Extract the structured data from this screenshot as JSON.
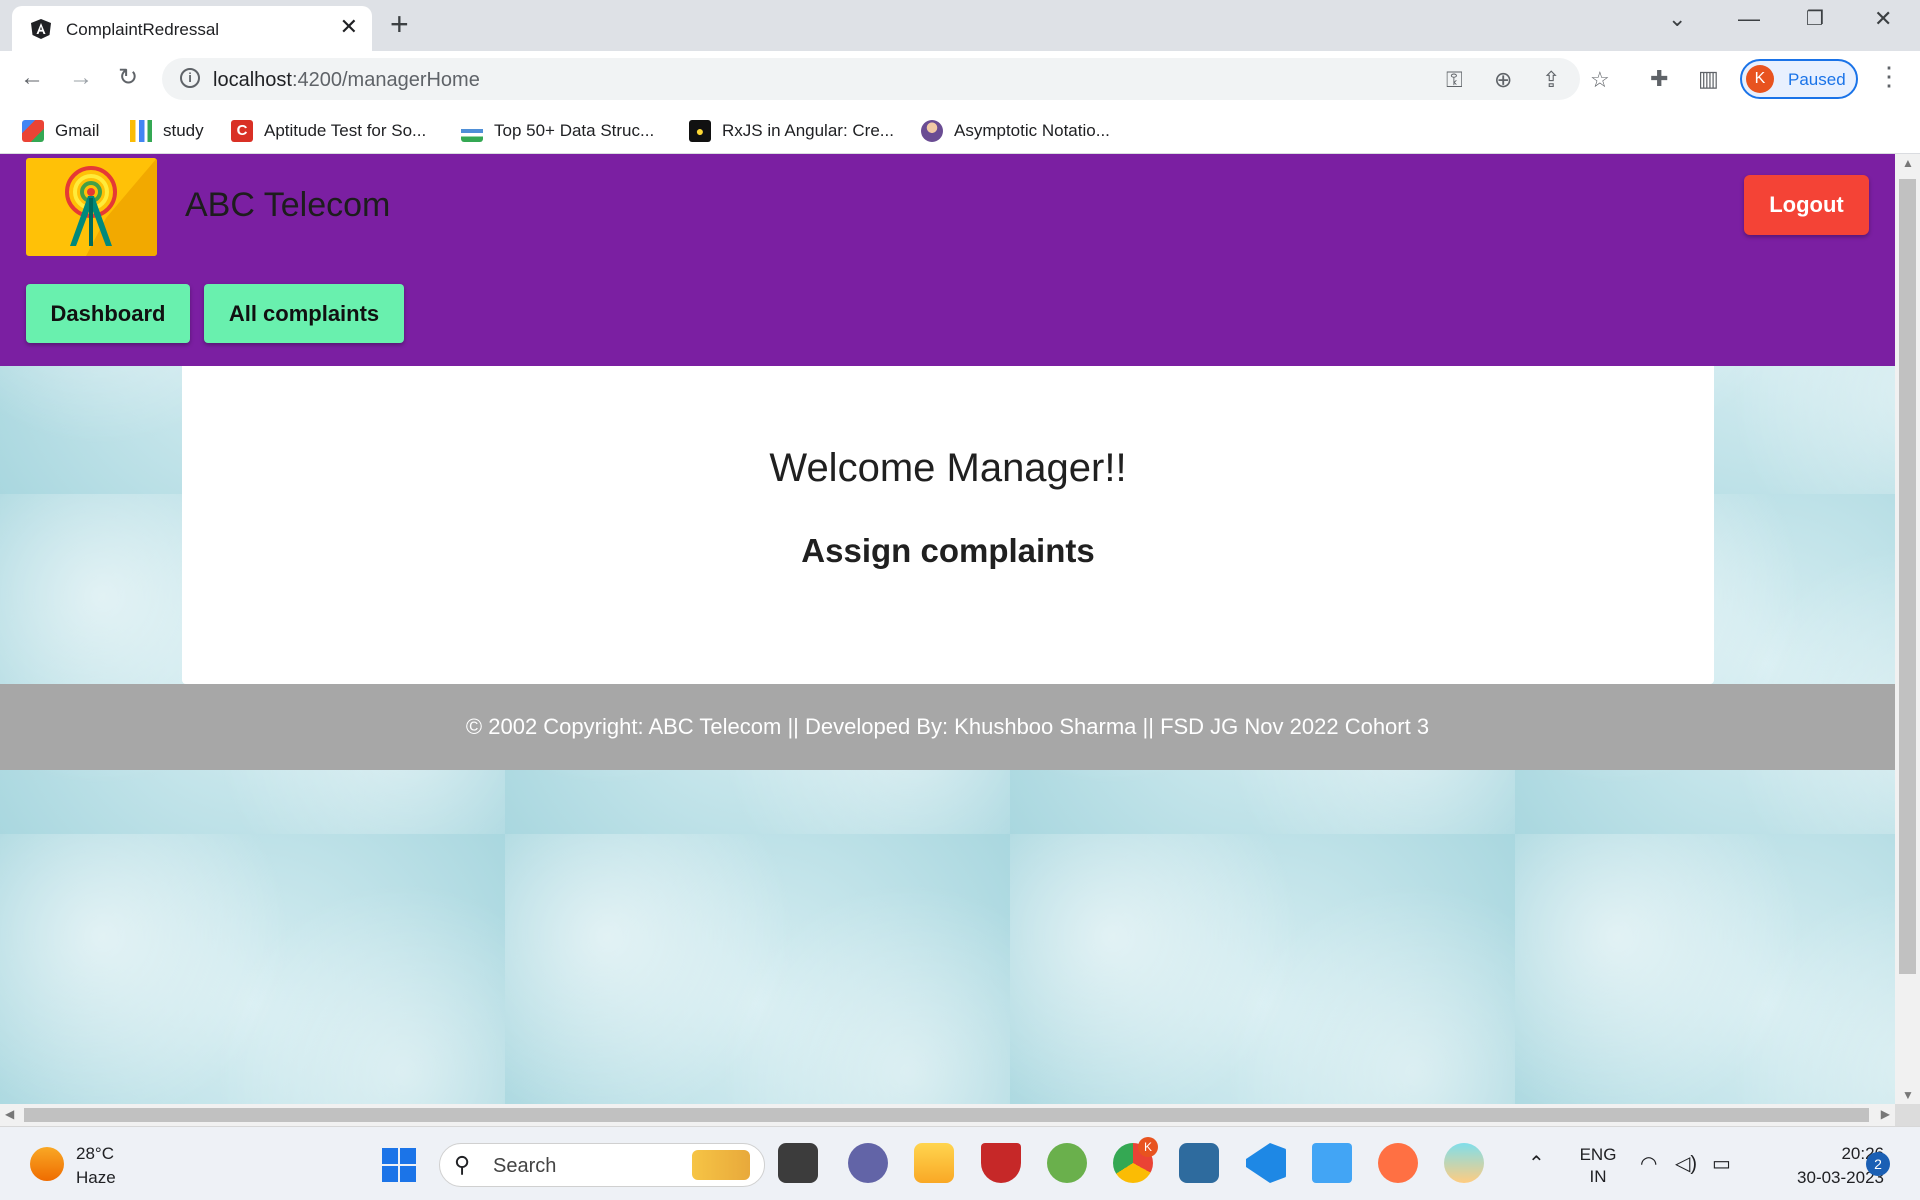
{
  "browser": {
    "tab_title": "ComplaintRedressal",
    "url_host": "localhost",
    "url_path": ":4200/managerHome",
    "profile_initial": "K",
    "profile_status": "Paused"
  },
  "bookmarks": [
    {
      "label": "Gmail",
      "icon": "gmail-icon",
      "color": "#ea4335"
    },
    {
      "label": "study",
      "icon": "study-bars-icon",
      "color": "#fbbc04"
    },
    {
      "label": "Aptitude Test for So...",
      "icon": "c-logo-icon",
      "color": "#d93025"
    },
    {
      "label": "Top 50+ Data Struc...",
      "icon": "ds-logo-icon",
      "color": "#4f8fd7"
    },
    {
      "label": "RxJS in Angular: Cre...",
      "icon": "lightbulb-icon",
      "color": "#111111"
    },
    {
      "label": "Asymptotic Notatio...",
      "icon": "person-avatar-icon",
      "color": "#9c7ba3"
    }
  ],
  "app": {
    "brand": "ABC Telecom",
    "logout_label": "Logout",
    "nav": [
      "Dashboard",
      "All complaints"
    ],
    "welcome": "Welcome Manager!!",
    "subheading": "Assign complaints",
    "footer": "© 2002 Copyright: ABC Telecom || Developed By: Khushboo Sharma || FSD JG Nov 2022 Cohort 3",
    "colors": {
      "header": "#7b1fa2",
      "nav_button": "#69f0ae",
      "logout": "#f44336",
      "footer": "#a7a7a7"
    }
  },
  "taskbar": {
    "temperature": "28°C",
    "weather": "Haze",
    "search_placeholder": "Search",
    "lang_line1": "ENG",
    "lang_line2": "IN",
    "time": "20:26",
    "date": "30-03-2023",
    "notifications": "2",
    "chrome_badge": "K"
  }
}
